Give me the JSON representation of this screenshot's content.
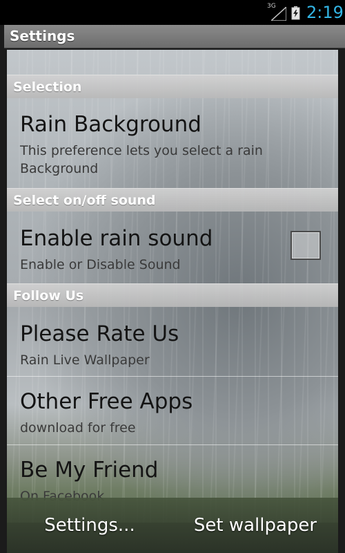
{
  "status_bar": {
    "network": "3G",
    "time": "2:19",
    "icons": [
      "signal-icon",
      "battery-charging-icon"
    ]
  },
  "title": "Settings",
  "sections": [
    {
      "header": "Selection",
      "items": [
        {
          "title": "Rain Background",
          "summary": "This preference lets you select a rain Background"
        }
      ]
    },
    {
      "header": "Select on/off sound",
      "items": [
        {
          "title": "Enable rain sound",
          "summary": "Enable or Disable Sound",
          "checked": false
        }
      ]
    },
    {
      "header": "Follow Us",
      "items": [
        {
          "title": "Please Rate Us",
          "summary": "Rain Live Wallpaper"
        },
        {
          "title": "Other Free Apps",
          "summary": "download for free"
        },
        {
          "title": "Be My Friend",
          "summary": "On Facebook"
        }
      ]
    }
  ],
  "bottom_bar": {
    "settings_label": "Settings...",
    "set_wallpaper_label": "Set wallpaper"
  },
  "colors": {
    "time_accent": "#33b5e5"
  }
}
